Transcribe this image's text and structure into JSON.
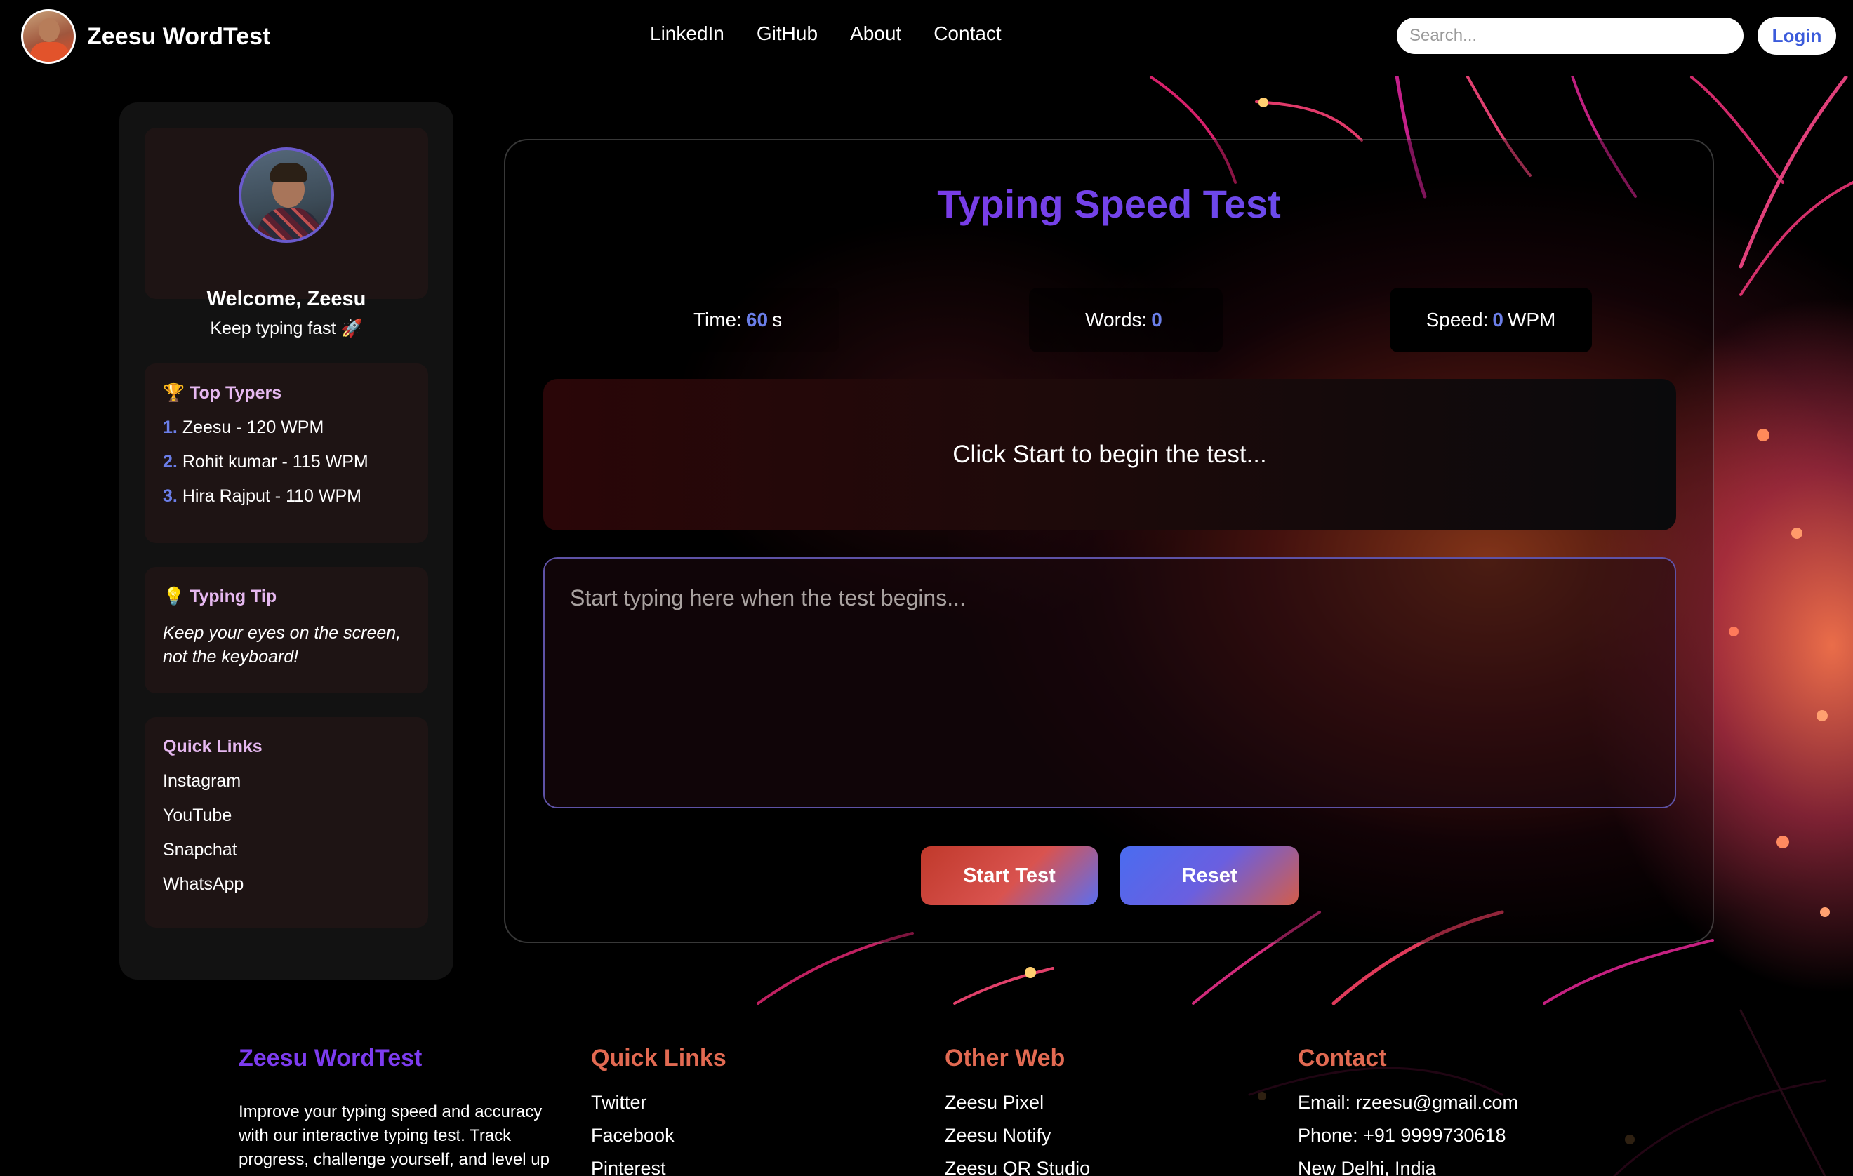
{
  "header": {
    "brand": "Zeesu WordTest",
    "nav": [
      "LinkedIn",
      "GitHub",
      "About",
      "Contact"
    ],
    "search_placeholder": "Search...",
    "login_label": "Login"
  },
  "sidebar": {
    "profile": {
      "welcome": "Welcome, Zeesu",
      "subtitle": "Keep typing fast 🚀"
    },
    "top_typers": {
      "title": "🏆 Top Typers",
      "items": [
        {
          "num": "1.",
          "text": "Zeesu - 120 WPM"
        },
        {
          "num": "2.",
          "text": "Rohit kumar - 115 WPM"
        },
        {
          "num": "3.",
          "text": "Hira Rajput - 110 WPM"
        }
      ]
    },
    "tip": {
      "title": "💡 Typing Tip",
      "text": "Keep your eyes on the screen, not the keyboard!"
    },
    "quick_links": {
      "title": "Quick Links",
      "items": [
        "Instagram",
        "YouTube",
        "Snapchat",
        "WhatsApp"
      ]
    }
  },
  "test": {
    "title": "Typing Speed Test",
    "time": {
      "label": "Time:",
      "value": "60",
      "unit": "s"
    },
    "words": {
      "label": "Words:",
      "value": "0"
    },
    "speed": {
      "label": "Speed:",
      "value": "0",
      "unit": "WPM"
    },
    "prompt": "Click Start to begin the test...",
    "input_placeholder": "Start typing here when the test begins...",
    "start_label": "Start Test",
    "reset_label": "Reset"
  },
  "footer": {
    "brand": {
      "title": "Zeesu WordTest",
      "text": "Improve your typing speed and accuracy with our interactive typing test. Track progress, challenge yourself, and level up"
    },
    "quick_links": {
      "title": "Quick Links",
      "items": [
        "Twitter",
        "Facebook",
        "Pinterest"
      ]
    },
    "other_web": {
      "title": "Other Web",
      "items": [
        "Zeesu Pixel",
        "Zeesu Notify",
        "Zeesu QR Studio"
      ]
    },
    "contact": {
      "title": "Contact",
      "items": [
        "Email: rzeesu@gmail.com",
        "Phone: +91 9999730618",
        "New Delhi, India"
      ]
    }
  },
  "colors": {
    "accent": "#6b7ee8",
    "title_gradient_start": "#8a2be2",
    "title_gradient_end": "#5b5bf0",
    "footer_heading": "#e26a52"
  }
}
